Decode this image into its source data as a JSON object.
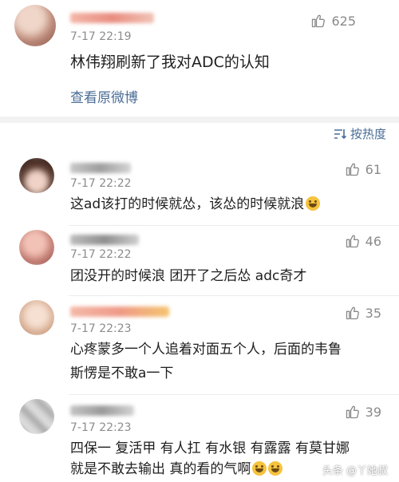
{
  "top_comment": {
    "time": "7-17 22:19",
    "text": "林伟翔刷新了我对ADC的认知",
    "likes": "625",
    "view_original": "查看原微博",
    "avatar_color": "#c79a8a"
  },
  "sort_label": "按热度",
  "comments": [
    {
      "time": "7-17 22:22",
      "text": "这ad该打的时候就怂，该怂的时候就浪",
      "likes": "61",
      "avatar_color": "#6b4b3e"
    },
    {
      "time": "7-17 22:22",
      "text": "团没开的时候浪 团开了之后怂 adc奇才",
      "likes": "46",
      "avatar_color": "#c9897f"
    },
    {
      "time": "7-17 22:23",
      "text_line1": "心疼蒙多一个人追着对面五个人，后面的韦鲁",
      "text_line2": "斯愣是不敢a一下",
      "likes": "35",
      "avatar_color": "#d6b49a"
    },
    {
      "time": "7-17 22:23",
      "text_line1": "四保一 复活甲 有人扛 有水银 有露露 有莫甘娜",
      "text_line2": "就是不敢去输出 真的看的气啊",
      "likes": "39",
      "avatar_color": "#b9b9b9"
    }
  ],
  "watermark": "头条 @丫她叔",
  "icons": [
    "thumbs-up-icon",
    "sort-icon",
    "grin-emoji-icon",
    "laugh-emoji-icon"
  ]
}
